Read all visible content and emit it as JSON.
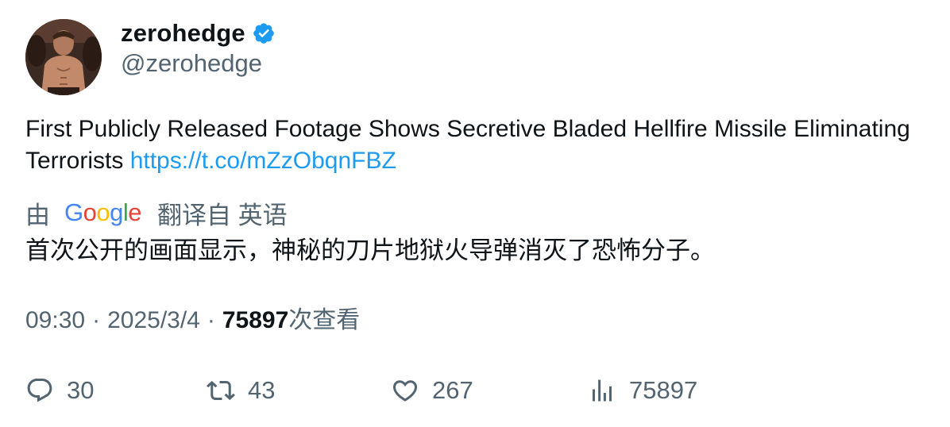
{
  "author": {
    "display_name": "zerohedge",
    "handle": "@zerohedge",
    "verified_icon": "verified-badge-icon",
    "avatar_icon": "avatar"
  },
  "tweet": {
    "text": "First Publicly Released Footage Shows Secretive Bladed Hellfire Missile Eliminating Terrorists ",
    "link": "https://t.co/mZzObqnFBZ"
  },
  "translation": {
    "prefix": "由",
    "provider_letters": [
      "G",
      "o",
      "o",
      "g",
      "l",
      "e"
    ],
    "suffix": "翻译自 英语",
    "text": "首次公开的画面显示，神秘的刀片地狱火导弹消灭了恐怖分子。"
  },
  "meta": {
    "time": "09:30",
    "separator": "·",
    "date": "2025/3/4",
    "views_count": "75897",
    "views_label": "次查看"
  },
  "actions": {
    "replies": "30",
    "retweets": "43",
    "likes": "267",
    "views": "75897"
  },
  "colors": {
    "text": "#0f1419",
    "muted": "#536471",
    "link": "#1d9bf0",
    "verified": "#1d9bf0"
  }
}
